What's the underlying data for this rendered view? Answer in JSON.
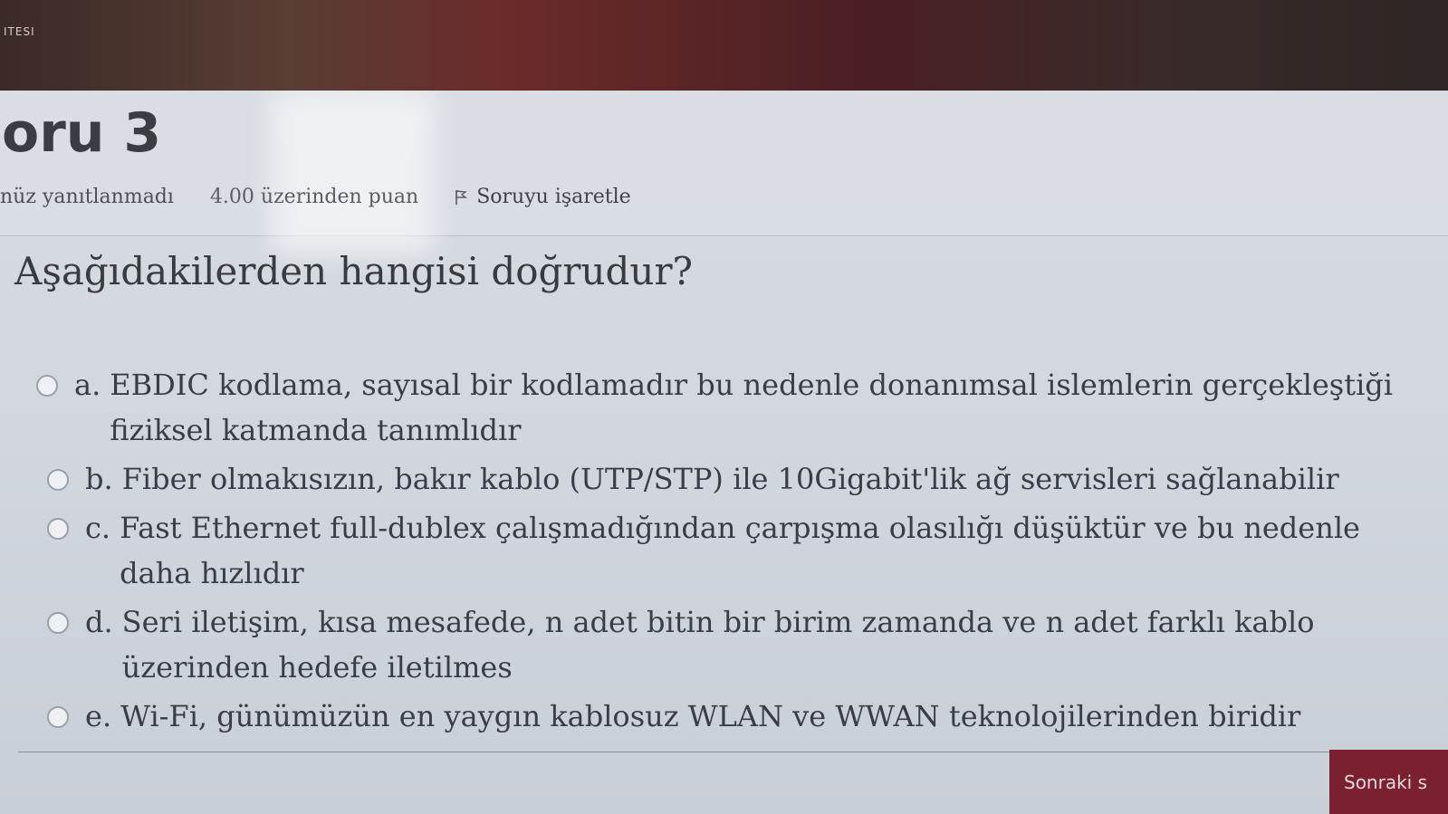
{
  "backdrop": {
    "label": "ITESI"
  },
  "question": {
    "title": "oru 3",
    "status": "nüz yanıtlanmadı",
    "grade": "4.00 üzerinden puan",
    "flag_label": "Soruyu işaretle",
    "prompt": "Aşağıdakilerden hangisi doğrudur?"
  },
  "answers": [
    {
      "letter": "a.",
      "text": "EBDIC kodlama, sayısal bir kodlamadır bu nedenle donanımsal islemlerin gerçekleştiği fiziksel katmanda tanımlıdır"
    },
    {
      "letter": "b.",
      "text": "Fiber olmakısızın, bakır kablo (UTP/STP) ile 10Gigabit'lik ağ servisleri sağlanabilir"
    },
    {
      "letter": "c.",
      "text": "Fast Ethernet full-dublex çalışmadığından çarpışma olasılığı düşüktür ve bu nedenle daha hızlıdır"
    },
    {
      "letter": "d.",
      "text": "Seri iletişim, kısa mesafede, n adet bitin bir birim zamanda ve n adet farklı kablo üzerinden hedefe iletilmes"
    },
    {
      "letter": "e.",
      "text": "Wi-Fi, günümüzün en yaygın kablosuz WLAN ve WWAN teknolojilerinden biridir"
    }
  ],
  "navigation": {
    "next_label": "Sonraki s"
  },
  "colors": {
    "accent": "#7a2030",
    "text": "#3a3d45",
    "panel": "#d5d9df"
  },
  "icons": {
    "flag": "flag-icon",
    "radio": "radio-icon"
  }
}
